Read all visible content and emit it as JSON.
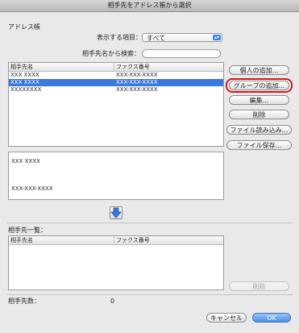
{
  "window": {
    "title": "相手先をアドレス帳から選択"
  },
  "address_book": {
    "section_label": "アドレス帳",
    "display_items_label": "表示する項目：",
    "display_items_value": "すべて",
    "search_label": "相手先名から検索：",
    "search_value": "",
    "columns": [
      "相手先名",
      "ファクス番号"
    ],
    "rows": [
      {
        "name": "XXX XXXX",
        "fax": "XXX-XXX-XXXX",
        "selected": false
      },
      {
        "name": "XXX XXXX",
        "fax": "XXX-XXX-XXXX",
        "selected": true
      },
      {
        "name": "XXXXXXXX",
        "fax": "XXX-XXX-XXXX",
        "selected": false
      }
    ]
  },
  "side_buttons": {
    "add_individual": "個人の追加...",
    "add_group": "グループの追加...",
    "edit": "編集...",
    "delete": "削除",
    "import_file": "ファイル読み込み...",
    "save_file": "ファイル保存..."
  },
  "detail": {
    "name": "XXX XXXX",
    "fax": "XXX-XXX-XXXX"
  },
  "recipients": {
    "section_label": "相手先一覧：",
    "columns": [
      "相手先名",
      "ファクス番号"
    ],
    "delete_label": "削除",
    "count_label": "相手先数：",
    "count_value": "0"
  },
  "footer": {
    "cancel_label": "キャンセル",
    "ok_label": "OK"
  },
  "colors": {
    "selection": "#3a78db",
    "highlight": "#d61a1a",
    "primary": "#4b8de8"
  }
}
